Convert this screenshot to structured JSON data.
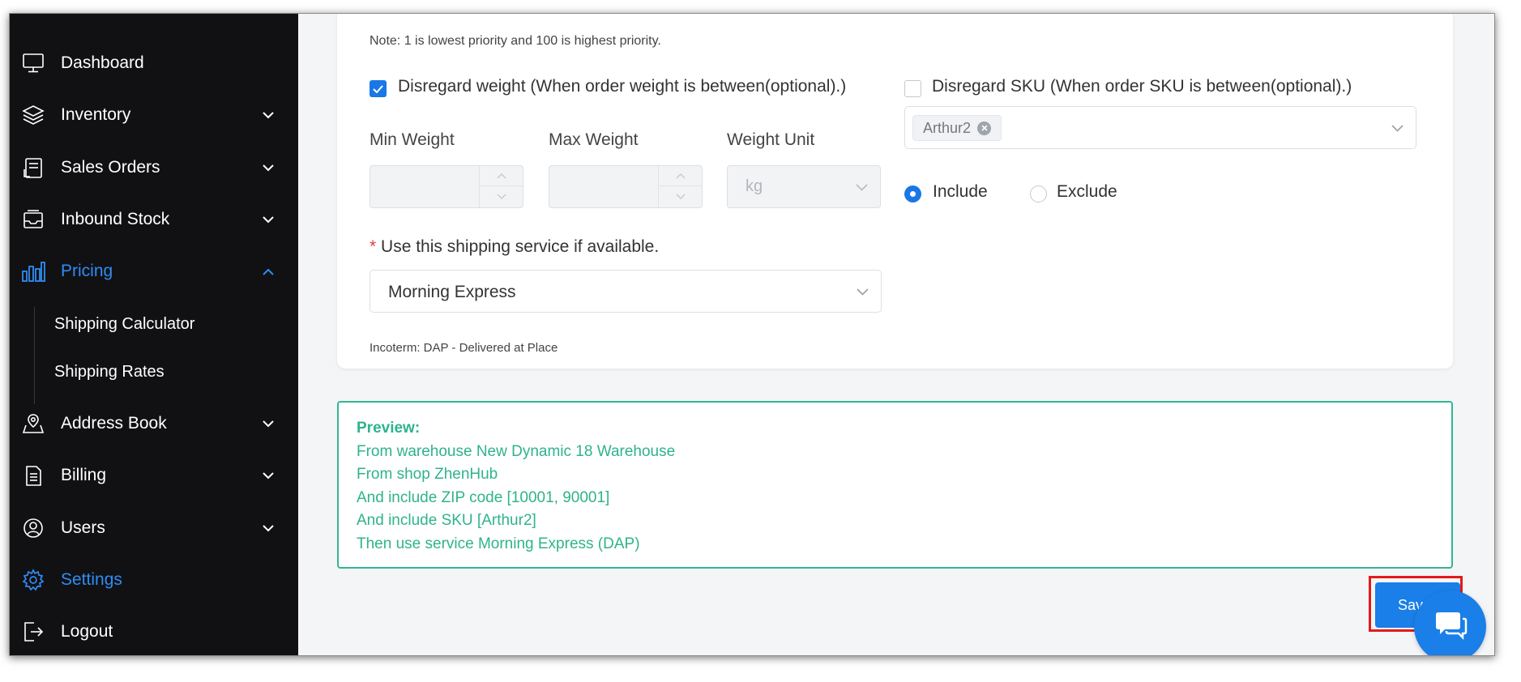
{
  "sidebar": {
    "items": [
      {
        "label": "Dashboard",
        "icon": "monitor-icon"
      },
      {
        "label": "Inventory",
        "icon": "layers-icon"
      },
      {
        "label": "Sales Orders",
        "icon": "receipt-icon"
      },
      {
        "label": "Inbound Stock",
        "icon": "inbox-icon"
      },
      {
        "label": "Pricing",
        "icon": "bar-chart-icon"
      },
      {
        "label": "Address Book",
        "icon": "map-pin-icon"
      },
      {
        "label": "Billing",
        "icon": "document-icon"
      },
      {
        "label": "Users",
        "icon": "user-icon"
      },
      {
        "label": "Settings",
        "icon": "gear-icon"
      },
      {
        "label": "Logout",
        "icon": "logout-icon"
      }
    ],
    "pricing_sub": [
      "Shipping Calculator",
      "Shipping Rates"
    ],
    "active_color": "#2f8cf5"
  },
  "form": {
    "note": "Note: 1 is lowest priority and 100 is highest priority.",
    "disregard_weight": {
      "label": "Disregard weight (When order weight is between(optional).)",
      "checked": true
    },
    "disregard_sku": {
      "label": "Disregard SKU (When order SKU is between(optional).)",
      "checked": false
    },
    "min_weight_label": "Min Weight",
    "max_weight_label": "Max Weight",
    "weight_unit_label": "Weight Unit",
    "weight_unit_value": "kg",
    "sku_tag": "Arthur2",
    "include_label": "Include",
    "exclude_label": "Exclude",
    "service_required_mark": "*",
    "service_label": "Use this shipping service if available.",
    "service_value": "Morning Express",
    "incoterm": "Incoterm: DAP - Delivered at Place"
  },
  "preview": {
    "title": "Preview:",
    "lines": [
      "From warehouse New Dynamic 18 Warehouse",
      "From shop ZhenHub",
      "And include ZIP code [10001, 90001]",
      "And include SKU [Arthur2]",
      "Then use service Morning Express (DAP)"
    ],
    "color": "#2fb38c"
  },
  "actions": {
    "save_label": "Sav",
    "accent": "#1a7fe8"
  }
}
